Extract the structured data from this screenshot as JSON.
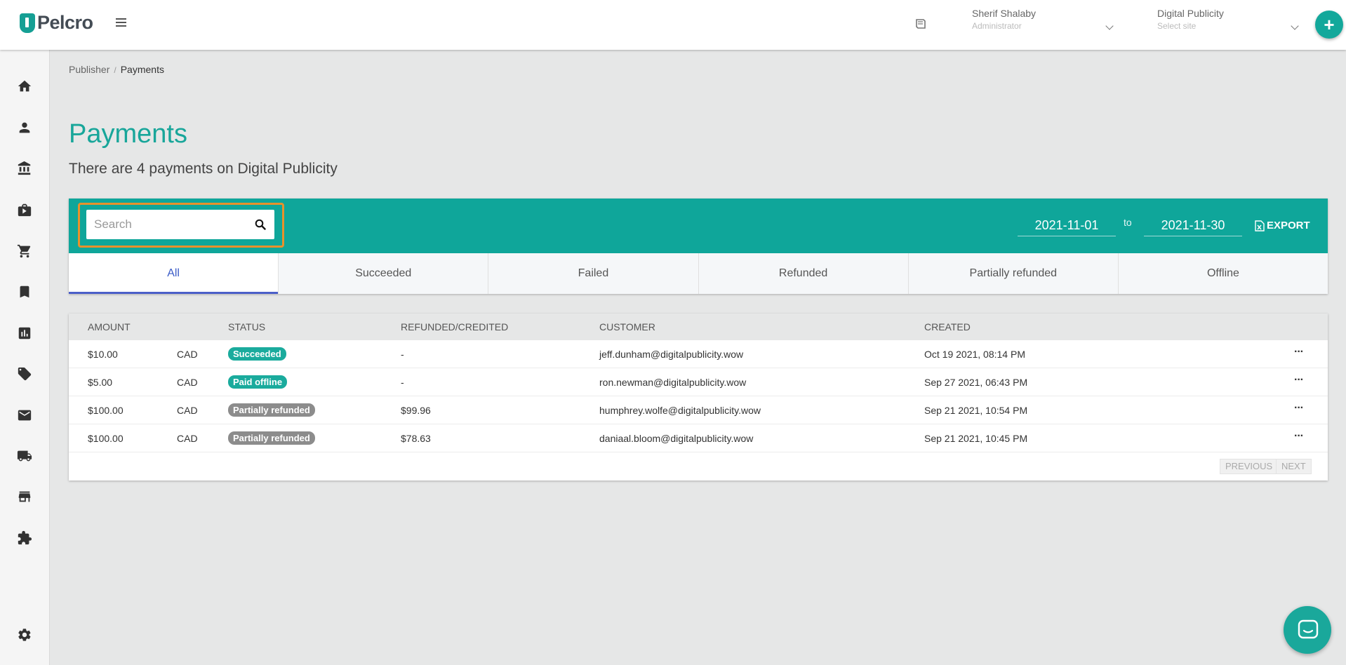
{
  "brand": {
    "name": "Pelcro",
    "color": "#159f94"
  },
  "header": {
    "user_name": "Sherif Shalaby",
    "user_role": "Administrator",
    "site_name": "Digital Publicity",
    "site_placeholder": "Select site",
    "add_label": "+"
  },
  "sidebar": {
    "items": [
      {
        "icon": "home-icon"
      },
      {
        "icon": "person-icon"
      },
      {
        "icon": "bank-icon"
      },
      {
        "icon": "briefcase-icon"
      },
      {
        "icon": "cart-icon"
      },
      {
        "icon": "bookmark-icon"
      },
      {
        "icon": "chart-icon"
      },
      {
        "icon": "ticket-icon"
      },
      {
        "icon": "mail-icon"
      },
      {
        "icon": "truck-icon"
      },
      {
        "icon": "store-icon"
      },
      {
        "icon": "puzzle-icon"
      },
      {
        "icon": "gear-icon"
      }
    ]
  },
  "breadcrumb": {
    "parent": "Publisher",
    "separator": "/",
    "current": "Payments"
  },
  "page": {
    "title": "Payments",
    "subtitle": "There are 4 payments on Digital Publicity"
  },
  "toolbar": {
    "search_placeholder": "Search",
    "search_value": "",
    "date_from": "2021-11-01",
    "date_to_label": "to",
    "date_to": "2021-11-30",
    "export_label": "EXPORT",
    "accent": "#0fa69a",
    "highlight": "#e8912b"
  },
  "tabs": [
    {
      "label": "All",
      "active": true
    },
    {
      "label": "Succeeded",
      "active": false
    },
    {
      "label": "Failed",
      "active": false
    },
    {
      "label": "Refunded",
      "active": false
    },
    {
      "label": "Partially refunded",
      "active": false
    },
    {
      "label": "Offline",
      "active": false
    }
  ],
  "table": {
    "columns": [
      "AMOUNT",
      "STATUS",
      "REFUNDED/CREDITED",
      "CUSTOMER",
      "CREATED"
    ],
    "rows": [
      {
        "amount": "$10.00",
        "currency": "CAD",
        "status": "Succeeded",
        "status_color": "#1aab9d",
        "refunded": "-",
        "customer": "jeff.dunham@digitalpublicity.wow",
        "created": "Oct 19 2021, 08:14 PM",
        "menu": "···"
      },
      {
        "amount": "$5.00",
        "currency": "CAD",
        "status": "Paid offline",
        "status_color": "#1aab9d",
        "refunded": "-",
        "customer": "ron.newman@digitalpublicity.wow",
        "created": "Sep 27 2021, 06:43 PM",
        "menu": "···"
      },
      {
        "amount": "$100.00",
        "currency": "CAD",
        "status": "Partially refunded",
        "status_color": "#8c8c8c",
        "refunded": "$99.96",
        "customer": "humphrey.wolfe@digitalpublicity.wow",
        "created": "Sep 21 2021, 10:54 PM",
        "menu": "···"
      },
      {
        "amount": "$100.00",
        "currency": "CAD",
        "status": "Partially refunded",
        "status_color": "#8c8c8c",
        "refunded": "$78.63",
        "customer": "daniaal.bloom@digitalpublicity.wow",
        "created": "Sep 21 2021, 10:45 PM",
        "menu": "···"
      }
    ]
  },
  "pagination": {
    "previous": "PREVIOUS",
    "next": "NEXT"
  },
  "chat": {
    "icon": "chat-icon"
  }
}
